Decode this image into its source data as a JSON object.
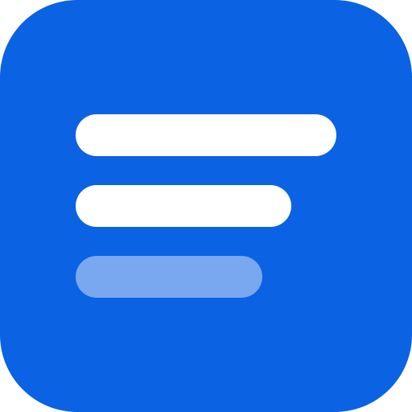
{
  "app_icon": {
    "name": "text-lines-app-icon",
    "background_color": "#0b62e3",
    "line_color": "#ffffff",
    "lines": [
      {
        "name": "line-1",
        "opacity": 1
      },
      {
        "name": "line-2",
        "opacity": 1
      },
      {
        "name": "line-3",
        "opacity": 0.45
      }
    ]
  }
}
